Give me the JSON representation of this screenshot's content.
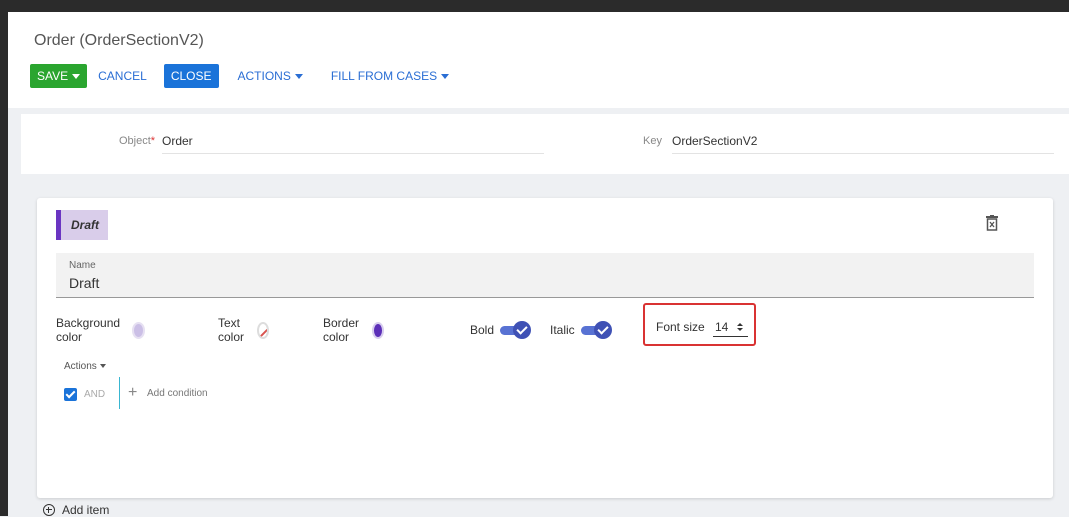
{
  "header": {
    "title": "Order (OrderSectionV2)",
    "toolbar": {
      "save_label": "SAVE",
      "cancel_label": "CANCEL",
      "close_label": "CLOSE",
      "actions_label": "ACTIONS",
      "fill_label": "FILL FROM CASES"
    }
  },
  "fields": {
    "object_label": "Object",
    "object_required": "*",
    "object_value": "Order",
    "key_label": "Key",
    "key_value": "OrderSectionV2"
  },
  "item": {
    "badge_label": "Draft",
    "name_label": "Name",
    "name_value": "Draft",
    "properties": {
      "background_color_label": "Background color",
      "background_color": "#cbbfe6",
      "text_color_label": "Text color",
      "text_color": "none",
      "border_color_label": "Border color",
      "border_color": "#5c2fb8",
      "bold_label": "Bold",
      "bold_on": true,
      "italic_label": "Italic",
      "italic_on": true,
      "font_size_label": "Font size",
      "font_size_value": "14"
    },
    "actions_label": "Actions",
    "condition": {
      "checked": true,
      "operator_label": "AND",
      "add_condition_label": "Add condition"
    }
  },
  "footer": {
    "add_item_label": "Add item"
  },
  "colors": {
    "save_green": "#2aa52f",
    "close_blue": "#1a73d9",
    "link_blue": "#2a6ed4",
    "toggle_indigo": "#3f51b5",
    "highlight_red": "#d93232",
    "badge_accent": "#6a35c2"
  }
}
